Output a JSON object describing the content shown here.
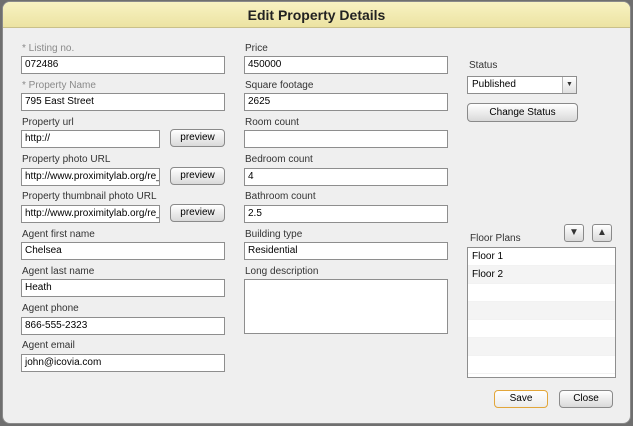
{
  "title": "Edit Property Details",
  "left_fields": [
    {
      "label": "* Listing no.",
      "value": "072486"
    },
    {
      "label": "* Property Name",
      "value": "795 East Street"
    },
    {
      "label": "Property url",
      "value": "http://",
      "button": "preview"
    },
    {
      "label": "Property photo URL",
      "value": "http://www.proximitylab.org/re_pl",
      "button": "preview"
    },
    {
      "label": "Property thumbnail photo URL",
      "value": "http://www.proximitylab.org/re_pl",
      "button": "preview"
    },
    {
      "label": "Agent first name",
      "value": "Chelsea"
    },
    {
      "label": "Agent last name",
      "value": "Heath"
    },
    {
      "label": "Agent phone",
      "value": "866-555-2323"
    },
    {
      "label": "Agent email",
      "value": "john@icovia.com"
    }
  ],
  "middle_fields": [
    {
      "label": "Price",
      "value": "450000"
    },
    {
      "label": "Square footage",
      "value": "2625"
    },
    {
      "label": "Room count",
      "value": ""
    },
    {
      "label": "Bedroom count",
      "value": "4"
    },
    {
      "label": "Bathroom count",
      "value": "2.5"
    },
    {
      "label": "Building type",
      "value": "Residential"
    },
    {
      "label": "Long description",
      "value": ""
    }
  ],
  "status": {
    "label": "Status",
    "value": "Published",
    "change_button": "Change Status"
  },
  "floor_plans": {
    "label": "Floor Plans",
    "items": [
      "Floor 1",
      "Floor 2",
      "",
      "",
      "",
      "",
      ""
    ],
    "icons": {
      "down": "arrow-down-icon",
      "up": "arrow-up-icon"
    }
  },
  "footer": {
    "save": "Save",
    "close": "Close"
  }
}
